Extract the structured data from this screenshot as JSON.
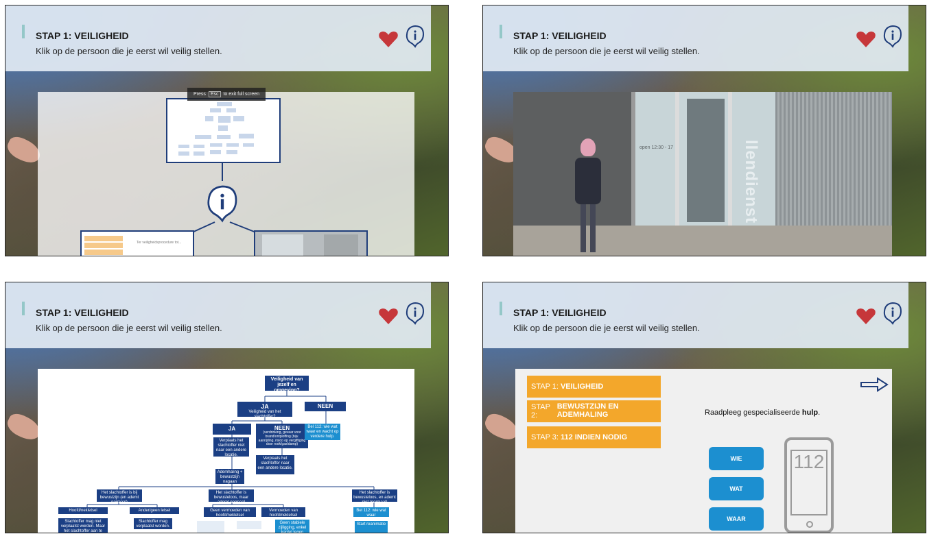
{
  "header": {
    "title": "STAP 1: VEILIGHEID",
    "subtitle": "Klik op de persoon die je eerst wil veilig stellen."
  },
  "icons": {
    "lives": "heart-icon",
    "info": "info-head-icon",
    "next": "arrow-right-icon"
  },
  "colors": {
    "accent": "#f3a72b",
    "flow_dark": "#1b3f84",
    "flow_light": "#1c8fd0",
    "heart": "#c6373a"
  },
  "panel1": {
    "esc_press": "Press",
    "esc_key": "Esc",
    "esc_rest": "to exit full screen",
    "info_glyph": "i",
    "preview_caption": "Ter veiligheidsprocedure tot..."
  },
  "panel2": {
    "sign_text": "llendienst",
    "door_text": "open 12:30 - 17"
  },
  "flow": {
    "root": "Veiligheid van jezelf en omgeving?",
    "ja_title": "JA",
    "ja_sub": "Veiligheid van het slachtoffer?",
    "neen": "NEEN",
    "ja2": "JA",
    "neen2_title": "NEEN",
    "neen2_sub": "(verdrinking, gevaar voor brand/ontploffing (bijv. aanrijding, risico op vergiftiging door rook/gas/damp)",
    "bel112": "Bel 112: wie wat waar en wacht op verdere hulp.",
    "verplaats_niet": "Verplaats het slachtoffer niet naar een andere locatie.",
    "verplaats": "Verplaats het slachtoffer naar een andere locatie.",
    "ademhaling": "Ademhaling + bewustzijn nagaan",
    "bewust": "Het slachtoffer is bij bewustzijn (en ademt normaal)",
    "bewusteloos": "Het slachtoffer is bewusteloos, maar ademt normaal",
    "bewusteloos2": "Het slachtoffer is bewusteloos, en ademt niet (normaal)",
    "hoofd": "Hoofd/nekletsel",
    "ander": "Ander/geen letsel",
    "geen_verm": "Geen vermoeden van hoofd/nekletsel",
    "verm": "Vermoeden van hoofd/nekletsel",
    "bel112b": "Bel 112: wie wat waar",
    "mag_niet": "Slachtoffer mag niet verplaatst worden. Maar het slachtoffer aan te blijven liggen",
    "mag": "Slachtoffer mag verplaatst worden.",
    "stabiele": "Geen stabiele zijligging, enkel kantel tegen",
    "reanimatie": "Start reanimatie"
  },
  "panel4": {
    "menu": [
      {
        "prefix": "STAP 1:",
        "label": "VEILIGHEID"
      },
      {
        "prefix": "STAP 2:",
        "label": "BEWUSTZIJN EN ADEMHALING"
      },
      {
        "prefix": "STAP 3:",
        "label": "112 INDIEN NODIG"
      }
    ],
    "instruction_pre": "Raadpleeg gespecialiseerde ",
    "instruction_bold": "hulp",
    "instruction_post": ".",
    "buttons": [
      "WIE",
      "WAT",
      "WAAR"
    ],
    "phone_number": "112"
  }
}
